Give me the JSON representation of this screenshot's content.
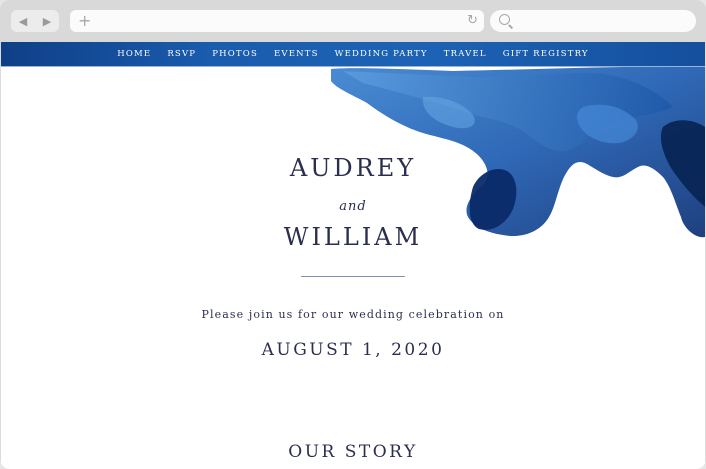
{
  "browser": {
    "back_glyph": "◀",
    "forward_glyph": "▶",
    "new_tab_glyph": "+",
    "reload_glyph": "↻",
    "url": "",
    "search": ""
  },
  "nav": {
    "items": [
      "HOME",
      "RSVP",
      "PHOTOS",
      "EVENTS",
      "WEDDING PARTY",
      "TRAVEL",
      "GIFT REGISTRY"
    ],
    "background": "#1a5cae"
  },
  "hero": {
    "name1": "AUDREY",
    "and": "and",
    "name2": "WILLIAM",
    "invitation": "Please join us for our wedding celebration on",
    "date": "AUGUST 1, 2020",
    "section_heading": "OUR STORY",
    "text_color": "#2b2f4d",
    "ink_colors": [
      "#1d5bb0",
      "#0c2f73",
      "#3f86d3"
    ]
  }
}
